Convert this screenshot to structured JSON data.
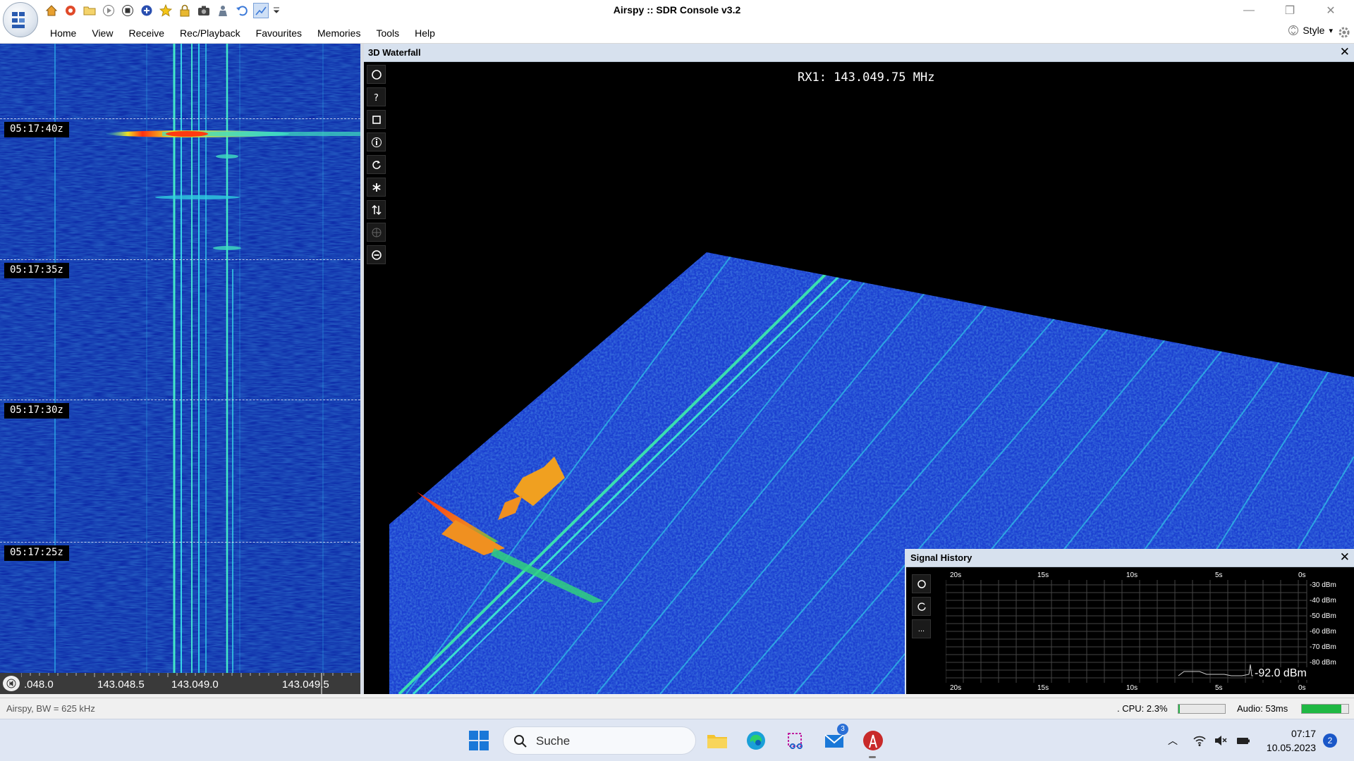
{
  "window": {
    "title": "Airspy :: SDR Console v3.2",
    "minimize": "—",
    "restore": "❐",
    "close": "✕"
  },
  "menu": {
    "items": [
      "Home",
      "View",
      "Receive",
      "Rec/Playback",
      "Favourites",
      "Memories",
      "Tools",
      "Help"
    ],
    "style_label": "Style",
    "style_arrow": "▾"
  },
  "left_waterfall": {
    "time_labels": [
      "05:17:40z",
      "05:17:35z",
      "05:17:30z",
      "05:17:25z"
    ],
    "freq_labels": [
      ".048.0",
      "143.048.5",
      "143.049.0",
      "143.049.5"
    ]
  },
  "panel_3d": {
    "title": "3D Waterfall",
    "close": "✕",
    "rx_frequency": "RX1: 143.049.75 MHz",
    "tools": [
      "circle-icon",
      "help-icon",
      "square-icon",
      "info-icon",
      "rotate-icon",
      "asterisk-icon",
      "swap-vertical-icon",
      "crosshair-icon",
      "minus-circle-icon"
    ]
  },
  "signal_history": {
    "title": "Signal History",
    "close": "✕",
    "time_labels": [
      "20s",
      "15s",
      "10s",
      "5s",
      "0s"
    ],
    "dbm_labels": [
      "-30 dBm",
      "-40 dBm",
      "-50 dBm",
      "-60 dBm",
      "-70 dBm",
      "-80 dBm"
    ],
    "current_level": "-92.0 dBm",
    "more_button": "..."
  },
  "status": {
    "left": "Airspy, BW = 625 kHz",
    "cpu": ". CPU: 2.3%",
    "cpu_fraction": 0.023,
    "audio": "Audio: 53ms",
    "audio_fraction": 0.85
  },
  "taskbar": {
    "search_placeholder": "Suche",
    "mail_badge": "3",
    "clock_time": "07:17",
    "clock_date": "10.05.2023",
    "notification_count": "2",
    "tray_chevron": "︿"
  },
  "colors": {
    "waterfall_bg": "#0a1a7a",
    "signal_line": "#33e0e0",
    "accent_blue": "#d7e1ee"
  }
}
